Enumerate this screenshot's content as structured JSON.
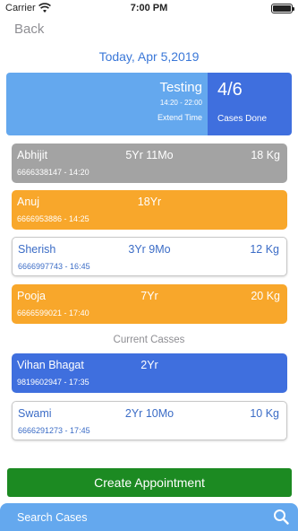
{
  "status_bar": {
    "carrier": "Carrier",
    "time": "7:00 PM"
  },
  "nav": {
    "back_label": "Back"
  },
  "date": "Today, Apr 5,2019",
  "summary": {
    "title": "Testing",
    "hours": "14:20 - 22:00",
    "extend_label": "Extend Time",
    "count": "4/6",
    "count_label": "Cases Done"
  },
  "appointments": [
    {
      "name": "Abhijit",
      "age": "5Yr 11Mo",
      "weight": "18 Kg",
      "sub": "6666338147 - 14:20",
      "style": "gray"
    },
    {
      "name": "Anuj",
      "age": "18Yr",
      "weight": "",
      "sub": "6666953886 - 14:25",
      "style": "orange"
    },
    {
      "name": "Sherish",
      "age": "3Yr 9Mo",
      "weight": "12 Kg",
      "sub": "6666997743 - 16:45",
      "style": "outlined"
    },
    {
      "name": "Pooja",
      "age": "7Yr",
      "weight": "20 Kg",
      "sub": "6666599021 - 17:40",
      "style": "orange"
    }
  ],
  "current_label": "Current Casses",
  "current_cases": [
    {
      "name": "Vihan Bhagat",
      "age": "2Yr",
      "weight": "",
      "sub": "9819602947 - 17:35",
      "style": "blue"
    },
    {
      "name": "Swami",
      "age": "2Yr 10Mo",
      "weight": "10 Kg",
      "sub": "6666291273 - 17:45",
      "style": "outlined"
    }
  ],
  "create_label": "Create Appointment",
  "search": {
    "label": "Search Cases",
    "icon": "search-icon"
  },
  "colors": {
    "accent_blue": "#3f6fde",
    "light_blue": "#64a8ee",
    "orange": "#f8a72b",
    "gray": "#a3a3a3",
    "green": "#1c8a22"
  }
}
